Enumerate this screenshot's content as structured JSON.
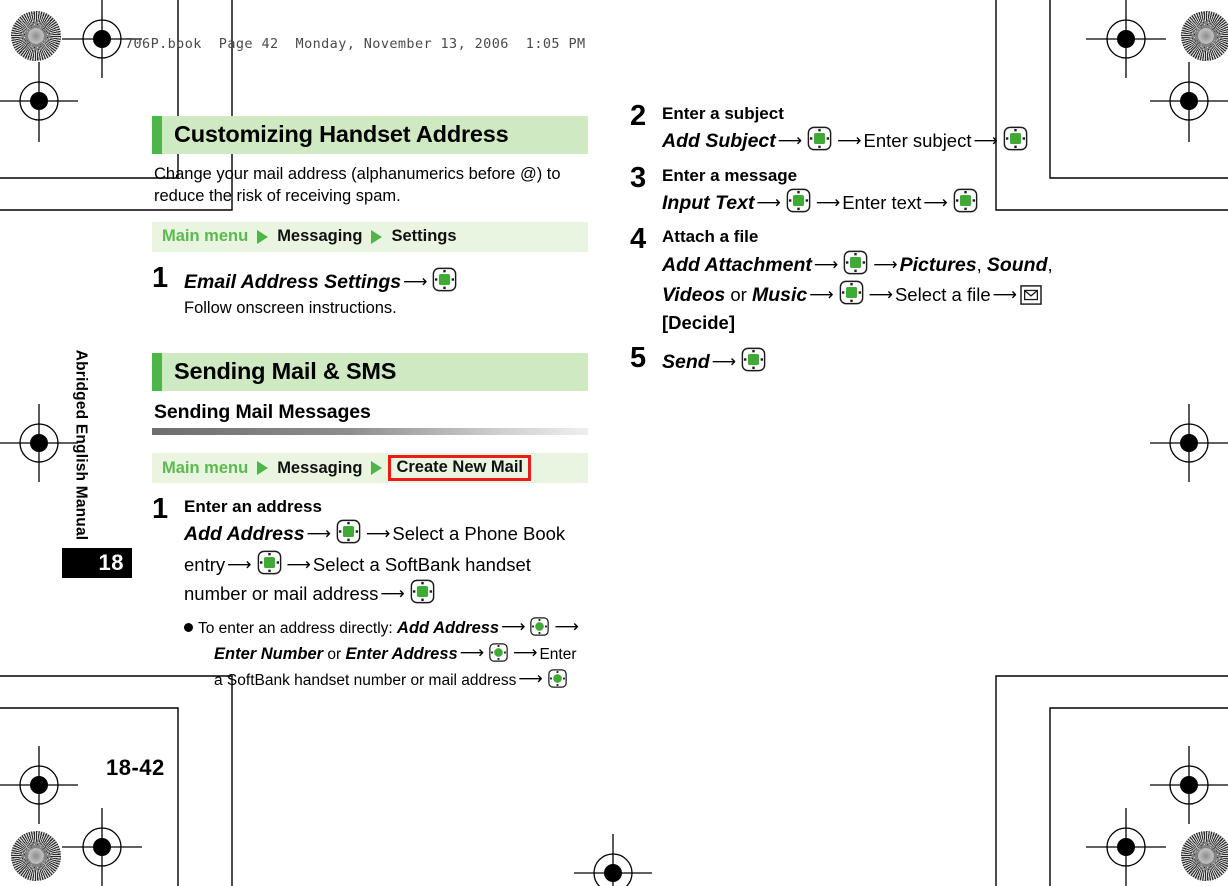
{
  "page": {
    "filestamp": "706P.book  Page 42  Monday, November 13, 2006  1:05 PM",
    "running_head": "Abridged English Manual",
    "chapter_tab": "18",
    "folio": "18-42"
  },
  "colors": {
    "banner_bg": "#cfeac2",
    "banner_accent": "#4cb648",
    "path_bg": "#e9f5e1",
    "path_green_text": "#5bb94f",
    "highlight_red": "#ee1c16",
    "key_green": "#3faa35"
  },
  "icons": {
    "navigation_key": "dpad-center-key-icon",
    "mail_key": "envelope-key-icon",
    "path_arrow": "triangle-right-icon",
    "step_arrow": "arrow-right-icon"
  },
  "left_column": {
    "section1": {
      "banner_title": "Customizing Handset Address",
      "lead": "Change your mail address (alphanumerics before @) to reduce the risk of receiving spam.",
      "path": {
        "main": "Main menu",
        "seg1": "Messaging",
        "seg2": "Settings",
        "highlight_last": false
      },
      "steps": [
        {
          "num": "1",
          "head": "",
          "body_parts": [
            {
              "t": "Email Address Settings",
              "style": "big-italic"
            },
            {
              "t": "→",
              "style": "arrow"
            },
            {
              "t": "",
              "style": "keyicon"
            }
          ],
          "note": "Follow onscreen instructions."
        }
      ]
    },
    "section2": {
      "banner_title": "Sending Mail & SMS",
      "subhead": "Sending Mail Messages",
      "path": {
        "main": "Main menu",
        "seg1": "Messaging",
        "seg2": "Create New Mail",
        "highlight_last": true
      },
      "steps": [
        {
          "num": "1",
          "head": "Enter an address",
          "body_parts": [
            {
              "t": "Add Address",
              "style": "big-italic"
            },
            {
              "t": "→",
              "style": "arrow"
            },
            {
              "t": "",
              "style": "keyicon"
            },
            {
              "t": "→",
              "style": "arrow"
            },
            {
              "t": "Select a Phone Book entry",
              "style": "plain"
            },
            {
              "t": "→",
              "style": "arrow"
            },
            {
              "t": "",
              "style": "keyicon"
            },
            {
              "t": "→",
              "style": "arrow"
            },
            {
              "t": "Select a SoftBank handset number or mail address",
              "style": "plain"
            },
            {
              "t": "→",
              "style": "arrow"
            },
            {
              "t": "",
              "style": "keyicon"
            }
          ],
          "subnote_parts": [
            {
              "t": "To enter an address directly:",
              "style": "plain"
            },
            {
              "t": "Add Address",
              "style": "bi"
            },
            {
              "t": "→",
              "style": "arrow"
            },
            {
              "t": "",
              "style": "keyicon-sm"
            },
            {
              "t": "→",
              "style": "arrow"
            },
            {
              "t": "Enter Number",
              "style": "bi"
            },
            {
              "t": "or",
              "style": "plain"
            },
            {
              "t": "Enter Address",
              "style": "bi"
            },
            {
              "t": "→",
              "style": "arrow"
            },
            {
              "t": "",
              "style": "keyicon-sm"
            },
            {
              "t": "→",
              "style": "arrow"
            },
            {
              "t": "Enter a SoftBank handset number or mail address",
              "style": "plain"
            },
            {
              "t": "→",
              "style": "arrow"
            },
            {
              "t": "",
              "style": "keyicon-sm"
            }
          ]
        }
      ]
    }
  },
  "right_column": {
    "steps": [
      {
        "num": "2",
        "head": "Enter a subject",
        "line1": {
          "label": "Add Subject",
          "mid": "Enter subject"
        }
      },
      {
        "num": "3",
        "head": "Enter a message",
        "line1": {
          "label": "Input Text",
          "mid": "Enter text"
        }
      },
      {
        "num": "4",
        "head": "Attach a file",
        "parts": {
          "p1": "Add Attachment",
          "p2": "Pictures",
          "p3": "Sound",
          "p4": "Videos",
          "or": "or",
          "p5": "Music",
          "p6": "Select a file",
          "p7": "[Decide]"
        }
      },
      {
        "num": "5",
        "head": "",
        "label": "Send"
      }
    ]
  }
}
